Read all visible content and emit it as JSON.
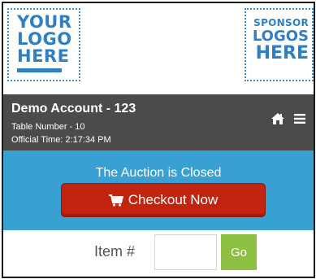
{
  "logos": {
    "left": {
      "line1": "YOUR",
      "line2": "LOGO",
      "line3": "HERE"
    },
    "right": {
      "line1": "SPONSOR",
      "line2": "LOGOS",
      "line3": "HERE"
    }
  },
  "account": {
    "title": "Demo Account - 123",
    "table": "Table Number - 10",
    "time": "Official Time: 2:17:34 PM",
    "icons": [
      "home-icon",
      "menu-icon"
    ]
  },
  "auction": {
    "status": "The Auction is Closed",
    "checkout_label": "Checkout Now",
    "checkout_icon": "cart-icon"
  },
  "item_search": {
    "label": "Item #",
    "value": "",
    "go_label": "Go"
  },
  "colors": {
    "logo_blue": "#2f7fc4",
    "account_bar": "#4b4b4b",
    "auction_bar": "#39a0d4",
    "checkout_red": "#c2240f",
    "go_green": "#8dc041"
  }
}
